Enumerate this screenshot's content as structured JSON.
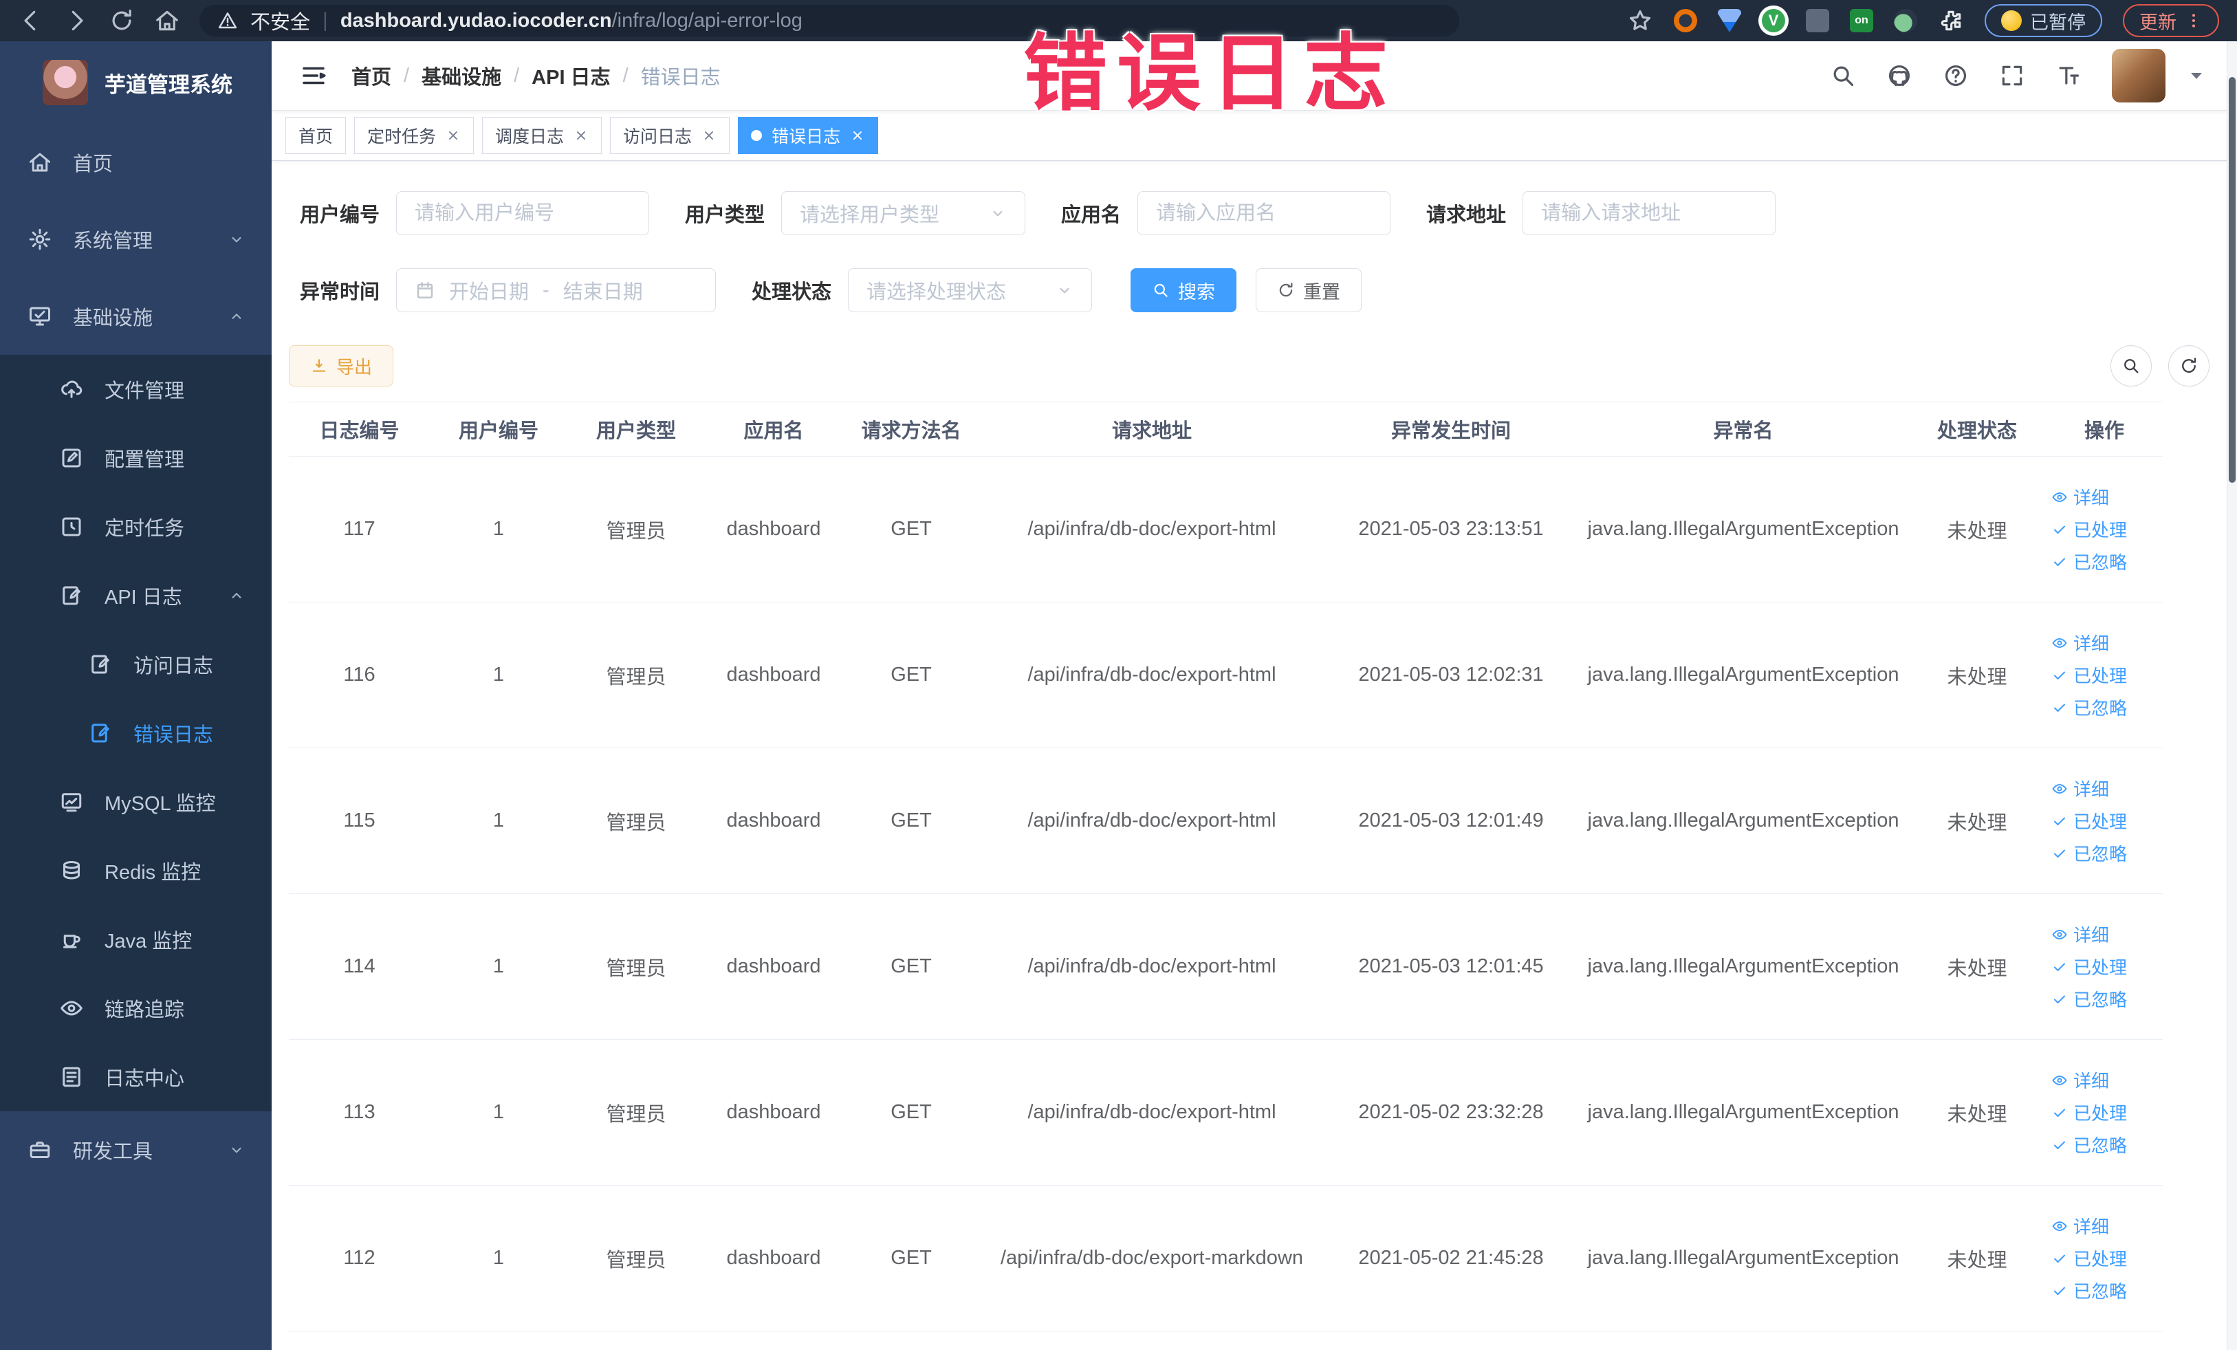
{
  "browser": {
    "security_label": "不安全",
    "url_domain": "dashboard.yudao.iocoder.cn",
    "url_path": "/infra/log/api-error-log",
    "paused_badge": "已暂停",
    "update_button": "更新"
  },
  "annotation": {
    "text": "错误日志",
    "color": "#f0325a"
  },
  "sidebar": {
    "title": "芋道管理系统",
    "items": [
      {
        "label": "首页",
        "icon": "home-icon",
        "level": 0,
        "submenu": false
      },
      {
        "label": "系统管理",
        "icon": "gear-icon",
        "level": 0,
        "submenu": false,
        "chevron": "down"
      },
      {
        "label": "基础设施",
        "icon": "infra-icon",
        "level": 0,
        "submenu": false,
        "chevron": "up"
      },
      {
        "label": "文件管理",
        "icon": "upload-icon",
        "level": 1,
        "submenu": true
      },
      {
        "label": "配置管理",
        "icon": "edit-icon",
        "level": 1,
        "submenu": true
      },
      {
        "label": "定时任务",
        "icon": "timer-icon",
        "level": 1,
        "submenu": true
      },
      {
        "label": "API 日志",
        "icon": "api-log-icon",
        "level": 1,
        "submenu": true,
        "chevron": "up"
      },
      {
        "label": "访问日志",
        "icon": "access-log-icon",
        "level": 2,
        "submenu": true
      },
      {
        "label": "错误日志",
        "icon": "error-log-icon",
        "level": 2,
        "submenu": true,
        "active": true
      },
      {
        "label": "MySQL 监控",
        "icon": "mysql-icon",
        "level": 1,
        "submenu": true
      },
      {
        "label": "Redis 监控",
        "icon": "redis-icon",
        "level": 1,
        "submenu": true
      },
      {
        "label": "Java 监控",
        "icon": "java-icon",
        "level": 1,
        "submenu": true
      },
      {
        "label": "链路追踪",
        "icon": "trace-eye-icon",
        "level": 1,
        "submenu": true
      },
      {
        "label": "日志中心",
        "icon": "log-center-icon",
        "level": 1,
        "submenu": true
      },
      {
        "label": "研发工具",
        "icon": "toolbox-icon",
        "level": 0,
        "submenu": false,
        "chevron": "down"
      }
    ]
  },
  "header": {
    "breadcrumb": [
      "首页",
      "基础设施",
      "API 日志",
      "错误日志"
    ]
  },
  "tabs": [
    {
      "label": "首页",
      "closable": false,
      "active": false
    },
    {
      "label": "定时任务",
      "closable": true,
      "active": false
    },
    {
      "label": "调度日志",
      "closable": true,
      "active": false
    },
    {
      "label": "访问日志",
      "closable": true,
      "active": false
    },
    {
      "label": "错误日志",
      "closable": true,
      "active": true
    }
  ],
  "filters": {
    "user_id": {
      "label": "用户编号",
      "placeholder": "请输入用户编号"
    },
    "user_type": {
      "label": "用户类型",
      "placeholder": "请选择用户类型"
    },
    "app_name": {
      "label": "应用名",
      "placeholder": "请输入应用名"
    },
    "request_url": {
      "label": "请求地址",
      "placeholder": "请输入请求地址"
    },
    "exception_time": {
      "label": "异常时间",
      "start_placeholder": "开始日期",
      "separator": "-",
      "end_placeholder": "结束日期"
    },
    "process_status": {
      "label": "处理状态",
      "placeholder": "请选择处理状态"
    },
    "search_label": "搜索",
    "reset_label": "重置"
  },
  "toolbar": {
    "export_label": "导出"
  },
  "table": {
    "columns": [
      "日志编号",
      "用户编号",
      "用户类型",
      "应用名",
      "请求方法名",
      "请求地址",
      "异常发生时间",
      "异常名",
      "处理状态",
      "操作"
    ],
    "action_labels": [
      "详细",
      "已处理",
      "已忽略"
    ],
    "rows": [
      {
        "id": "117",
        "user_id": "1",
        "user_type": "管理员",
        "app": "dashboard",
        "method": "GET",
        "url": "/api/infra/db-doc/export-html",
        "time": "2021-05-03 23:13:51",
        "exception": "java.lang.IllegalArgumentException",
        "status": "未处理"
      },
      {
        "id": "116",
        "user_id": "1",
        "user_type": "管理员",
        "app": "dashboard",
        "method": "GET",
        "url": "/api/infra/db-doc/export-html",
        "time": "2021-05-03 12:02:31",
        "exception": "java.lang.IllegalArgumentException",
        "status": "未处理"
      },
      {
        "id": "115",
        "user_id": "1",
        "user_type": "管理员",
        "app": "dashboard",
        "method": "GET",
        "url": "/api/infra/db-doc/export-html",
        "time": "2021-05-03 12:01:49",
        "exception": "java.lang.IllegalArgumentException",
        "status": "未处理"
      },
      {
        "id": "114",
        "user_id": "1",
        "user_type": "管理员",
        "app": "dashboard",
        "method": "GET",
        "url": "/api/infra/db-doc/export-html",
        "time": "2021-05-03 12:01:45",
        "exception": "java.lang.IllegalArgumentException",
        "status": "未处理"
      },
      {
        "id": "113",
        "user_id": "1",
        "user_type": "管理员",
        "app": "dashboard",
        "method": "GET",
        "url": "/api/infra/db-doc/export-html",
        "time": "2021-05-02 23:32:28",
        "exception": "java.lang.IllegalArgumentException",
        "status": "未处理"
      },
      {
        "id": "112",
        "user_id": "1",
        "user_type": "管理员",
        "app": "dashboard",
        "method": "GET",
        "url": "/api/infra/db-doc/export-markdown",
        "time": "2021-05-02 21:45:28",
        "exception": "java.lang.IllegalArgumentException",
        "status": "未处理"
      }
    ]
  },
  "colors": {
    "accent": "#409eff",
    "sidebar_bg": "#2c4163",
    "submenu_bg": "#1f3147",
    "warning": "#e6a23c",
    "annotation_red": "#f0325a"
  }
}
